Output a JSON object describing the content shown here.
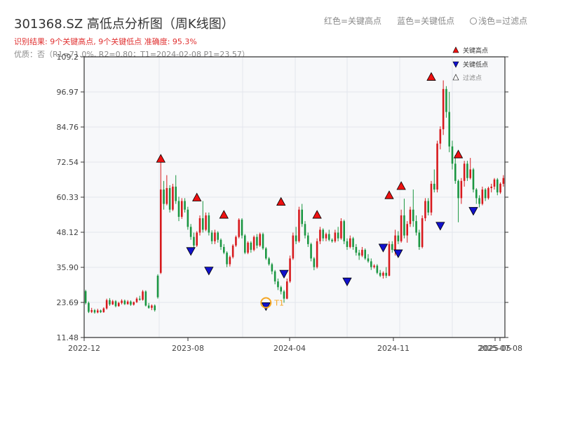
{
  "title": "301368.SZ 高低点分析图（周K线图）",
  "result_text": "识别结果: 9个关键高点, 9个关键低点  准确度: 95.3%",
  "quality_text": "优质：否（R1=71.0%, R2=0.80；T1=2024-02-08 P1=23.57）",
  "top_legend": {
    "red": "红色=关键高点",
    "blue": "蓝色=关键低点",
    "light": "浅色=过滤点"
  },
  "colors": {
    "up": "#d7191c",
    "down": "#1a9641",
    "high_marker": "#ee1111",
    "low_marker": "#1111cc",
    "t1_ring": "#f5a623",
    "plot_bg": "#f7f8fa",
    "grid": "#e3e6ec",
    "axis": "#333333"
  },
  "chart_data": {
    "type": "candlestick",
    "title": "301368.SZ 高低点分析图（周K线图）",
    "ylim": [
      11.48,
      109.2
    ],
    "y_ticks": [
      "11.48",
      "23.69",
      "35.90",
      "48.12",
      "60.33",
      "72.54",
      "84.76",
      "96.97",
      "109.2"
    ],
    "x_ticks": [
      "2022-12",
      "2023-08",
      "2024-04",
      "2024-11",
      "2025-05",
      "2025-07-08"
    ],
    "legend": [
      "关键高点",
      "关键低点",
      "过滤点"
    ],
    "annotation": "T1",
    "bars": [
      [
        27.6,
        28.1,
        23.0,
        23.5
      ],
      [
        23.5,
        24.0,
        20.0,
        20.4
      ],
      [
        20.4,
        21.8,
        20.0,
        21.0
      ],
      [
        21.0,
        21.4,
        19.8,
        20.2
      ],
      [
        20.2,
        21.5,
        19.9,
        20.9
      ],
      [
        20.9,
        21.2,
        20.0,
        20.3
      ],
      [
        20.3,
        22.0,
        20.1,
        21.6
      ],
      [
        21.6,
        25.0,
        21.2,
        24.5
      ],
      [
        24.5,
        25.2,
        22.5,
        23.0
      ],
      [
        23.0,
        24.6,
        22.8,
        24.1
      ],
      [
        24.1,
        24.5,
        22.0,
        22.4
      ],
      [
        22.4,
        23.9,
        22.2,
        23.5
      ],
      [
        23.5,
        24.8,
        23.0,
        24.3
      ],
      [
        24.3,
        24.7,
        22.8,
        23.1
      ],
      [
        23.1,
        24.5,
        22.9,
        24.0
      ],
      [
        24.0,
        24.4,
        22.5,
        22.9
      ],
      [
        22.9,
        24.0,
        22.6,
        23.8
      ],
      [
        23.8,
        25.5,
        23.5,
        25.0
      ],
      [
        25.0,
        26.0,
        24.3,
        24.6
      ],
      [
        24.6,
        28.0,
        24.3,
        27.5
      ],
      [
        27.5,
        27.9,
        22.3,
        22.6
      ],
      [
        22.6,
        23.5,
        21.5,
        21.8
      ],
      [
        21.8,
        23.0,
        21.0,
        22.6
      ],
      [
        22.6,
        23.0,
        20.5,
        21.0
      ],
      [
        33.0,
        33.5,
        25.0,
        25.5
      ],
      [
        34.0,
        72.5,
        33.6,
        63.0
      ],
      [
        63.0,
        66.0,
        56.0,
        58.0
      ],
      [
        58.0,
        68.0,
        57.5,
        63.5
      ],
      [
        63.5,
        64.5,
        55.0,
        56.0
      ],
      [
        56.0,
        65.0,
        55.5,
        64.0
      ],
      [
        64.0,
        68.0,
        58.0,
        59.0
      ],
      [
        59.0,
        60.5,
        52.0,
        53.5
      ],
      [
        53.5,
        60.0,
        52.8,
        59.0
      ],
      [
        59.0,
        60.0,
        55.0,
        56.0
      ],
      [
        56.0,
        57.0,
        49.0,
        50.0
      ],
      [
        50.0,
        51.0,
        45.5,
        46.5
      ],
      [
        46.5,
        48.0,
        42.8,
        43.5
      ],
      [
        43.5,
        48.5,
        43.0,
        48.0
      ],
      [
        48.0,
        54.0,
        47.0,
        53.0
      ],
      [
        53.0,
        59.0,
        48.0,
        49.0
      ],
      [
        49.0,
        55.0,
        48.5,
        54.0
      ],
      [
        54.0,
        55.0,
        47.0,
        48.0
      ],
      [
        48.0,
        48.8,
        44.0,
        45.0
      ],
      [
        45.0,
        49.0,
        44.0,
        48.0
      ],
      [
        48.0,
        48.5,
        44.5,
        45.5
      ],
      [
        45.5,
        46.0,
        42.0,
        43.0
      ],
      [
        43.0,
        44.0,
        40.5,
        41.0
      ],
      [
        41.0,
        41.5,
        36.0,
        37.0
      ],
      [
        37.0,
        40.0,
        36.2,
        39.5
      ],
      [
        39.5,
        44.0,
        39.0,
        43.5
      ],
      [
        43.5,
        47.0,
        43.0,
        46.5
      ],
      [
        46.5,
        53.0,
        46.0,
        52.5
      ],
      [
        52.5,
        53.0,
        46.0,
        47.0
      ],
      [
        47.0,
        47.5,
        40.5,
        41.0
      ],
      [
        41.0,
        45.0,
        40.5,
        44.5
      ],
      [
        44.5,
        45.0,
        41.0,
        42.0
      ],
      [
        42.0,
        47.0,
        41.5,
        46.5
      ],
      [
        46.5,
        47.5,
        42.5,
        43.5
      ],
      [
        43.5,
        48.0,
        43.0,
        47.5
      ],
      [
        47.5,
        48.0,
        42.0,
        42.5
      ],
      [
        42.5,
        43.0,
        38.5,
        39.0
      ],
      [
        39.0,
        39.5,
        36.5,
        37.0
      ],
      [
        37.0,
        37.5,
        33.5,
        34.5
      ],
      [
        34.5,
        35.0,
        30.0,
        31.0
      ],
      [
        31.0,
        32.0,
        28.0,
        29.0
      ],
      [
        29.0,
        29.5,
        26.5,
        27.5
      ],
      [
        27.5,
        28.0,
        23.6,
        25.0
      ],
      [
        25.0,
        32.0,
        24.8,
        31.0
      ],
      [
        31.0,
        40.0,
        30.5,
        39.0
      ],
      [
        39.0,
        48.0,
        38.5,
        47.0
      ],
      [
        47.0,
        50.0,
        44.0,
        45.0
      ],
      [
        45.0,
        57.0,
        44.5,
        56.0
      ],
      [
        56.0,
        58.0,
        50.0,
        51.0
      ],
      [
        51.0,
        52.0,
        46.0,
        47.0
      ],
      [
        47.0,
        48.0,
        43.0,
        44.0
      ],
      [
        44.0,
        44.5,
        38.0,
        39.0
      ],
      [
        39.0,
        39.5,
        34.9,
        36.0
      ],
      [
        36.0,
        46.0,
        35.5,
        45.0
      ],
      [
        45.0,
        50.0,
        44.0,
        49.0
      ],
      [
        49.0,
        49.5,
        45.0,
        46.0
      ],
      [
        46.0,
        48.0,
        45.0,
        47.5
      ],
      [
        47.5,
        49.0,
        45.0,
        45.5
      ],
      [
        45.5,
        46.0,
        44.5,
        45.0
      ],
      [
        45.0,
        49.0,
        44.5,
        48.0
      ],
      [
        48.0,
        50.0,
        45.0,
        46.0
      ],
      [
        46.0,
        53.0,
        45.5,
        52.0
      ],
      [
        52.0,
        52.5,
        44.0,
        45.0
      ],
      [
        45.0,
        46.0,
        42.0,
        43.0
      ],
      [
        43.0,
        47.0,
        42.5,
        46.0
      ],
      [
        46.0,
        46.5,
        42.0,
        43.0
      ],
      [
        43.0,
        44.0,
        40.0,
        41.0
      ],
      [
        41.0,
        42.0,
        38.5,
        40.0
      ],
      [
        40.0,
        43.0,
        39.5,
        42.0
      ],
      [
        42.0,
        42.5,
        38.5,
        39.0
      ],
      [
        39.0,
        40.5,
        37.5,
        38.0
      ],
      [
        38.0,
        39.0,
        35.0,
        36.0
      ],
      [
        36.0,
        37.0,
        35.5,
        36.5
      ],
      [
        36.5,
        37.0,
        33.5,
        34.0
      ],
      [
        34.0,
        35.0,
        32.5,
        33.0
      ],
      [
        33.0,
        34.5,
        32.0,
        34.0
      ],
      [
        34.0,
        36.0,
        32.2,
        33.0
      ],
      [
        33.0,
        45.0,
        32.8,
        44.0
      ],
      [
        44.0,
        45.0,
        41.0,
        42.0
      ],
      [
        42.0,
        49.0,
        40.0,
        47.0
      ],
      [
        47.0,
        48.5,
        44.0,
        45.0
      ],
      [
        45.0,
        56.0,
        44.5,
        54.0
      ],
      [
        54.0,
        59.8,
        46.0,
        47.0
      ],
      [
        47.0,
        52.0,
        44.5,
        51.0
      ],
      [
        51.0,
        57.0,
        50.0,
        56.0
      ],
      [
        56.0,
        63.0,
        50.0,
        52.0
      ],
      [
        52.0,
        54.0,
        47.0,
        48.0
      ],
      [
        48.0,
        49.0,
        42.0,
        43.0
      ],
      [
        43.0,
        54.0,
        42.5,
        53.0
      ],
      [
        53.0,
        60.0,
        52.0,
        59.0
      ],
      [
        59.0,
        60.0,
        54.0,
        55.0
      ],
      [
        55.0,
        66.0,
        54.0,
        65.0
      ],
      [
        65.0,
        70.0,
        62.0,
        63.0
      ],
      [
        63.0,
        80.0,
        62.0,
        79.0
      ],
      [
        79.0,
        85.0,
        77.0,
        84.0
      ],
      [
        84.0,
        101.0,
        82.0,
        98.0
      ],
      [
        98.0,
        99.0,
        88.0,
        90.0
      ],
      [
        90.0,
        97.0,
        76.0,
        78.0
      ],
      [
        78.0,
        80.0,
        70.0,
        72.0
      ],
      [
        72.0,
        75.0,
        65.0,
        66.0
      ],
      [
        66.0,
        66.5,
        51.6,
        60.0
      ],
      [
        60.0,
        67.0,
        58.0,
        66.0
      ],
      [
        66.0,
        73.0,
        64.0,
        72.0
      ],
      [
        72.0,
        73.0,
        66.0,
        67.0
      ],
      [
        67.0,
        74.0,
        66.5,
        70.0
      ],
      [
        70.0,
        70.5,
        62.0,
        63.0
      ],
      [
        63.0,
        63.5,
        58.0,
        60.0
      ],
      [
        60.0,
        61.0,
        56.8,
        58.0
      ],
      [
        58.0,
        64.0,
        57.5,
        63.0
      ],
      [
        63.0,
        63.5,
        59.0,
        60.0
      ],
      [
        60.0,
        64.0,
        59.5,
        63.5
      ],
      [
        63.5,
        65.0,
        62.0,
        64.0
      ],
      [
        64.0,
        67.0,
        63.0,
        66.5
      ],
      [
        66.5,
        67.0,
        61.0,
        62.0
      ],
      [
        62.0,
        65.5,
        61.5,
        65.0
      ],
      [
        65.0,
        68.0,
        64.0,
        67.0
      ]
    ],
    "key_highs": [
      [
        25,
        72.5
      ],
      [
        37,
        59.0
      ],
      [
        46,
        53.0
      ],
      [
        65,
        57.5
      ],
      [
        77,
        53.0
      ],
      [
        101,
        59.8
      ],
      [
        105,
        63.0
      ],
      [
        115,
        101.0
      ],
      [
        124,
        74.0
      ]
    ],
    "key_lows": [
      [
        35,
        42.8
      ],
      [
        41,
        36.0
      ],
      [
        60,
        23.6
      ],
      [
        66,
        34.9
      ],
      [
        87,
        32.2
      ],
      [
        99,
        44.0
      ],
      [
        104,
        42.0
      ],
      [
        118,
        51.6
      ],
      [
        129,
        56.8
      ]
    ],
    "t1_index": 60,
    "t1_value": 23.57
  }
}
